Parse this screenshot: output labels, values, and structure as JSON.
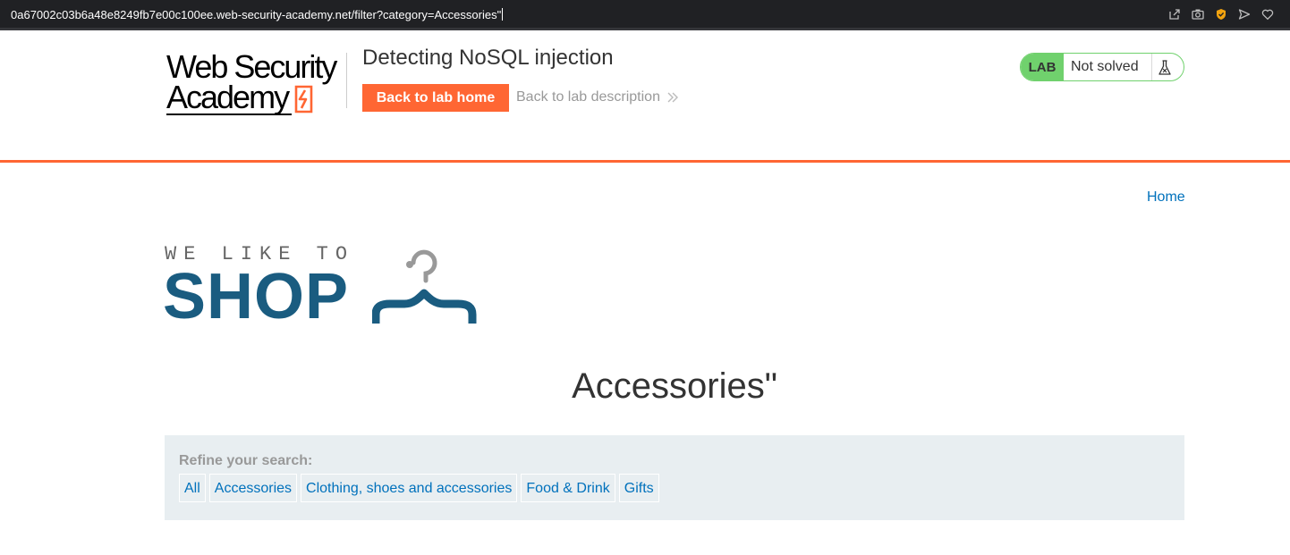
{
  "browser": {
    "url": "0a67002c03b6a48e8249fb7e00c100ee.web-security-academy.net/filter?category=Accessories\"",
    "icons": [
      "share-icon",
      "camera-icon",
      "shield-icon",
      "send-icon",
      "heart-icon"
    ]
  },
  "lab_header": {
    "logo_line1": "Web Security",
    "logo_line2": "Academy",
    "title": "Detecting NoSQL injection",
    "back_home_label": "Back to lab home",
    "back_description_label": "Back to lab description",
    "status_tag": "LAB",
    "status_text": "Not solved",
    "colors": {
      "accent": "#ff6633",
      "status_green": "#70d16d"
    }
  },
  "nav": {
    "home_label": "Home"
  },
  "shop_logo": {
    "tagline": "WE LIKE TO",
    "word": "SHOP"
  },
  "category_heading": "Accessories\"",
  "filter": {
    "label": "Refine your search:",
    "items": [
      "All",
      "Accessories",
      "Clothing, shoes and accessories",
      "Food & Drink",
      "Gifts"
    ]
  }
}
